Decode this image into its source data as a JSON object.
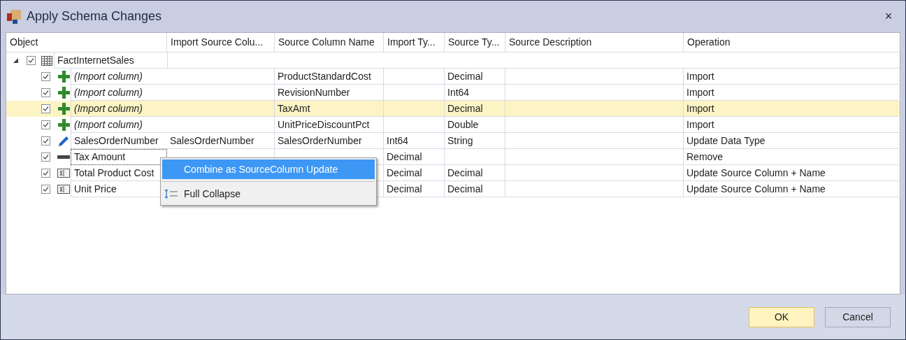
{
  "window": {
    "title": "Apply Schema Changes",
    "close": "×"
  },
  "table": {
    "columns": [
      "Object",
      "Import Source Colu...",
      "Source Column Name",
      "Import Ty...",
      "Source Ty...",
      "Source Description",
      "Operation"
    ],
    "rows": [
      {
        "kind": "table",
        "cells": [
          "FactInternetSales"
        ],
        "checked": true,
        "expanded": true,
        "selected": false,
        "focused": false
      },
      {
        "kind": "import",
        "cells": [
          "(Import column)",
          "",
          "ProductStandardCost",
          "",
          "Decimal",
          "",
          "Import"
        ],
        "checked": true,
        "selected": false,
        "focused": false
      },
      {
        "kind": "import",
        "cells": [
          "(Import column)",
          "",
          "RevisionNumber",
          "",
          "Int64",
          "",
          "Import"
        ],
        "checked": true,
        "selected": false,
        "focused": false
      },
      {
        "kind": "import",
        "cells": [
          "(Import column)",
          "",
          "TaxAmt",
          "",
          "Decimal",
          "",
          "Import"
        ],
        "checked": true,
        "selected": true,
        "focused": false
      },
      {
        "kind": "import",
        "cells": [
          "(Import column)",
          "",
          "UnitPriceDiscountPct",
          "",
          "Double",
          "",
          "Import"
        ],
        "checked": true,
        "selected": false,
        "focused": false
      },
      {
        "kind": "update",
        "cells": [
          "SalesOrderNumber",
          "SalesOrderNumber",
          "SalesOrderNumber",
          "Int64",
          "String",
          "",
          "Update Data Type"
        ],
        "checked": true,
        "selected": false,
        "focused": false
      },
      {
        "kind": "remove",
        "cells": [
          "Tax Amount",
          "",
          "",
          "Decimal",
          "",
          "",
          "Remove"
        ],
        "checked": true,
        "selected": false,
        "focused": true
      },
      {
        "kind": "column",
        "cells": [
          "Total Product Cost",
          "",
          "",
          "Decimal",
          "Decimal",
          "",
          "Update Source Column + Name"
        ],
        "checked": true,
        "selected": false,
        "focused": false
      },
      {
        "kind": "column",
        "cells": [
          "Unit Price",
          "",
          "",
          "Decimal",
          "Decimal",
          "",
          "Update Source Column + Name"
        ],
        "checked": true,
        "selected": false,
        "focused": false
      }
    ]
  },
  "context_menu": {
    "items": [
      {
        "kind": "command",
        "label": "Combine as SourceColumn Update",
        "selected": true
      },
      {
        "kind": "collapse",
        "label": "Full Collapse",
        "selected": false
      }
    ]
  },
  "buttons": [
    {
      "label": "OK",
      "default": true
    },
    {
      "label": "Cancel",
      "default": false
    }
  ]
}
